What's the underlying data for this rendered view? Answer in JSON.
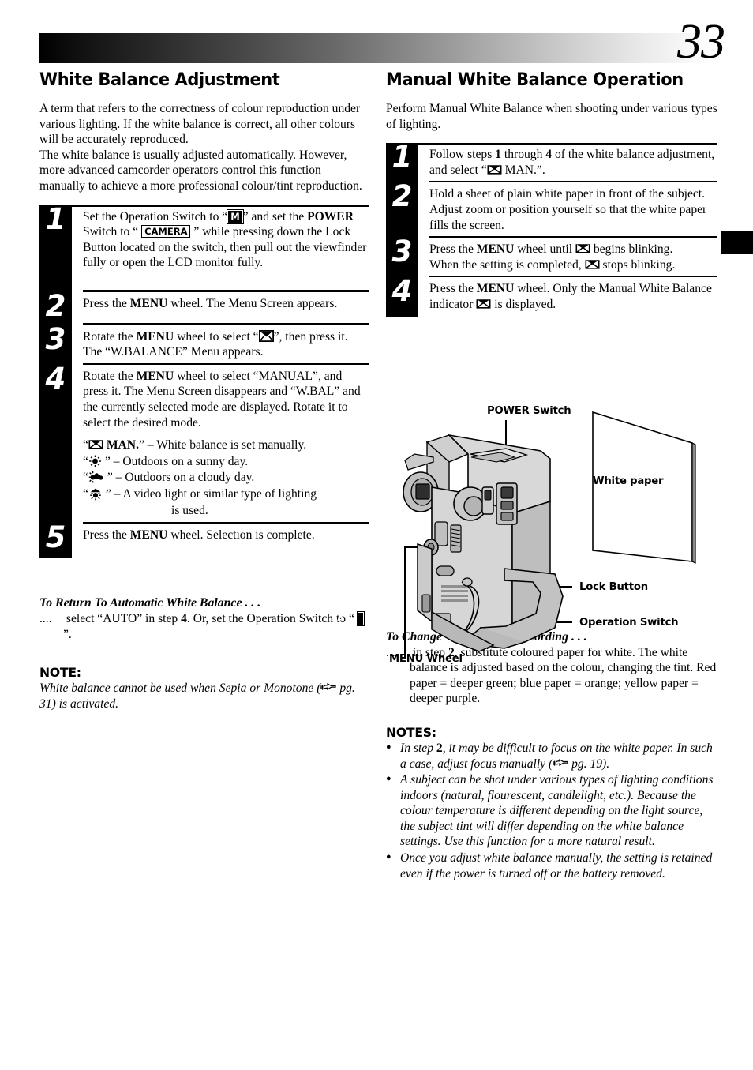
{
  "page": {
    "number": "33"
  },
  "left": {
    "title": "White Balance Adjustment",
    "intro1": "A term that refers to the correctness of colour reproduction under various lighting. If the white balance is correct, all other colours will be accurately reproduced.",
    "intro2": "The white balance is usually adjusted automatically. However, more advanced camcorder operators control this function manually to achieve a more professional colour/tint reproduction.",
    "steps": [
      {
        "num": "1",
        "t1": "Set the Operation Switch to “",
        "key1": "M",
        "t2": "” and set the ",
        "bold1": "POWER",
        "t3": " Switch to “ ",
        "key2": "CAMERA",
        "t4": " ” while pressing down the Lock Button located on the switch, then pull out the viewfinder fully or open the LCD monitor fully."
      },
      {
        "num": "2",
        "t1": "Press the ",
        "bold1": "MENU",
        "t2": " wheel. The Menu Screen appears."
      },
      {
        "num": "3",
        "t1": "Rotate the ",
        "bold1": "MENU",
        "t2": " wheel to select “",
        "t3": "”, then press it. The “W.BALANCE” Menu appears."
      },
      {
        "num": "4",
        "t1": "Rotate the ",
        "bold1": "MENU",
        "t2": " wheel to select “MANUAL”, and press it. The Menu Screen disappears and “W.BAL” and the currently selected mode are displayed. Rotate it to select the desired mode.",
        "modes": [
          {
            "icon": "wb-manual-icon",
            "label": "MAN.",
            "desc": "– White balance is set manually."
          },
          {
            "icon": "sun-icon",
            "label": "",
            "desc": "– Outdoors on a sunny day."
          },
          {
            "icon": "sun-cloud-icon",
            "label": "",
            "desc": "– Outdoors on a cloudy day."
          },
          {
            "icon": "video-light-icon",
            "label": "",
            "desc": "– A video light or similar type of lighting"
          },
          {
            "icon": "",
            "label": "",
            "desc": "is used."
          }
        ]
      },
      {
        "num": "5",
        "t1": "Press the ",
        "bold1": "MENU",
        "t2": " wheel. Selection is complete."
      }
    ],
    "return_head": "To Return To Automatic White Balance . . .",
    "return_dots": "....",
    "return_t1": " select “AUTO” in step ",
    "return_b1": "4",
    "return_t2": ". Or, set the Operation Switch to “ ",
    "return_key": "A",
    "return_t3": " ”.",
    "note_head": "NOTE:",
    "note_t1": "White balance cannot be used when Sepia or Monotone (",
    "note_t2": " pg. 31) is activated."
  },
  "right": {
    "title": "Manual White Balance Operation",
    "intro": "Perform Manual White Balance when shooting under various types of lighting.",
    "steps": [
      {
        "num": "1",
        "t1": "Follow steps ",
        "b1": "1",
        "t2": " through ",
        "b2": "4",
        "t3": " of the white balance adjustment, and select “",
        "t4": " MAN.”."
      },
      {
        "num": "2",
        "t1": "Hold a sheet of plain white paper in front of the subject. Adjust zoom or position yourself so that the white paper fills the screen."
      },
      {
        "num": "3",
        "t1": "Press the ",
        "b1": "MENU",
        "t2": " wheel until ",
        "t3": " begins blinking.",
        "t4": "When the setting is completed, ",
        "t5": " stops blinking."
      },
      {
        "num": "4",
        "t1": "Press the ",
        "b1": "MENU",
        "t2": " wheel. Only the Manual White Balance indicator ",
        "t3": " is displayed."
      }
    ],
    "illustration": {
      "power_switch": "POWER Switch",
      "white_paper": "White paper",
      "lock_button": "Lock Button",
      "operation_switch": "Operation Switch",
      "menu_wheel": "MENU Wheel"
    },
    "tint_head": "To Change The Tint For Recording . . .",
    "tint_dots": "....",
    "tint_t1": " in step ",
    "tint_b1": "2",
    "tint_t2": ", substitute coloured paper for white. The white balance is adjusted based on the colour, changing the tint. Red paper = deeper green; blue paper = orange; yellow paper = deeper purple.",
    "notes_head": "NOTES:",
    "notes": [
      {
        "t1": "In step ",
        "b1": "2",
        "t2": ", it may be difficult to focus on the white paper. In such a case, adjust focus manually (",
        "t3": " pg. 19)."
      },
      {
        "t1": "A subject can be shot under various types of lighting conditions indoors (natural, flourescent, candlelight, etc.). Because the colour temperature is different depending on the light source, the subject tint will differ depending on the white balance settings. Use this function for a more natural result."
      },
      {
        "t1": "Once you adjust white balance manually, the setting is retained even if the power is turned off or the battery removed."
      }
    ]
  },
  "colors": {
    "ink": "#000000",
    "paper": "#ffffff",
    "illus_body": "#d4d4d4",
    "illus_shade": "#a9a9a9"
  }
}
